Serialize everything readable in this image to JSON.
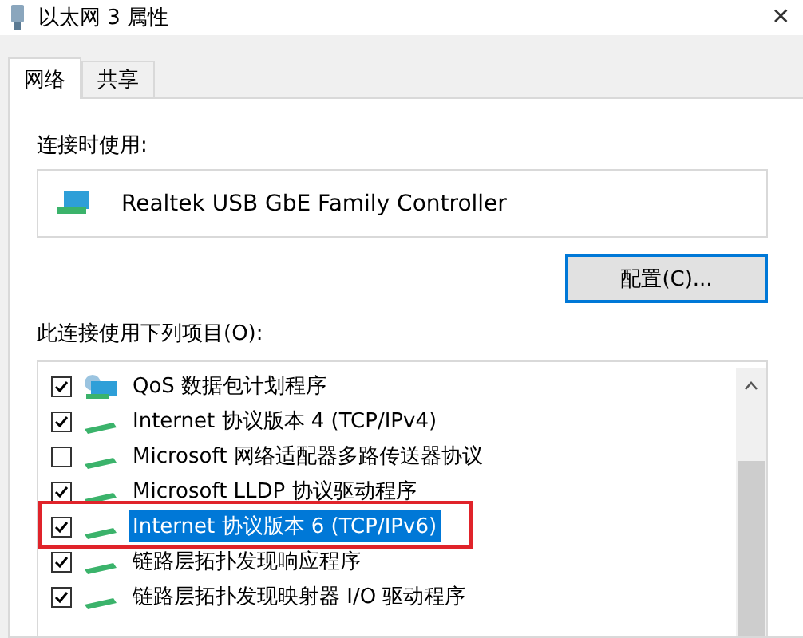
{
  "window": {
    "title": "以太网 3 属性",
    "close": "✕"
  },
  "tabs": [
    {
      "label": "网络",
      "selected": true
    },
    {
      "label": "共享",
      "selected": false
    }
  ],
  "connect_using": {
    "label": "连接时使用:",
    "adapter": "Realtek USB GbE Family Controller"
  },
  "configure_button": "配置(C)...",
  "items_label": "此连接使用下列项目(O):",
  "items": [
    {
      "label": "QoS 数据包计划程序",
      "kind": "service",
      "checked": true,
      "selected": false,
      "highlighted": false
    },
    {
      "label": "Internet 协议版本 4 (TCP/IPv4)",
      "kind": "protocol",
      "checked": true,
      "selected": false,
      "highlighted": false
    },
    {
      "label": "Microsoft 网络适配器多路传送器协议",
      "kind": "protocol",
      "checked": false,
      "selected": false,
      "highlighted": false
    },
    {
      "label": "Microsoft LLDP 协议驱动程序",
      "kind": "protocol",
      "checked": true,
      "selected": false,
      "highlighted": false
    },
    {
      "label": "Internet 协议版本 6 (TCP/IPv6)",
      "kind": "protocol",
      "checked": true,
      "selected": true,
      "highlighted": true
    },
    {
      "label": "链路层拓扑发现响应程序",
      "kind": "protocol",
      "checked": true,
      "selected": false,
      "highlighted": false
    },
    {
      "label": "链路层拓扑发现映射器 I/O 驱动程序",
      "kind": "protocol",
      "checked": true,
      "selected": false,
      "highlighted": false
    }
  ]
}
